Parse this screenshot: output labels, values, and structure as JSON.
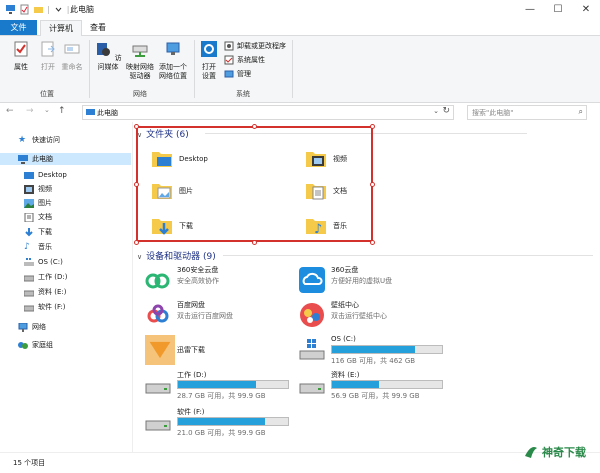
{
  "window": {
    "title": "此电脑",
    "quick_access_sep": "|",
    "minimize": "—",
    "maximize": "☐",
    "close": "✕"
  },
  "ribbon_tabs": {
    "file": "文件",
    "computer": "计算机",
    "view": "查看"
  },
  "ribbon": {
    "location_group": "位置",
    "network_group": "网络",
    "system_group": "系统",
    "properties": "属性",
    "open": "打开",
    "rename": "重命名",
    "access_media": "访问媒体",
    "map_drive_l1": "映射网络",
    "map_drive_l2": "驱动器",
    "add_location_l1": "添加一个",
    "add_location_l2": "网络位置",
    "open_settings_l1": "打开",
    "open_settings_l2": "设置",
    "uninstall": "卸载或更改程序",
    "sys_props": "系统属性",
    "manage": "管理"
  },
  "address": {
    "back": "←",
    "forward": "→",
    "recent": "⌄",
    "up": "↑",
    "path": "此电脑",
    "search_placeholder": "搜索\"此电脑\""
  },
  "nav_pane": {
    "quick_access": "快速访问",
    "this_pc": "此电脑",
    "desktop": "Desktop",
    "videos": "视频",
    "pictures": "图片",
    "documents": "文档",
    "downloads": "下载",
    "music": "音乐",
    "os_c": "OS (C:)",
    "work_d": "工作 (D:)",
    "data_e": "资料 (E:)",
    "soft_f": "软件 (F:)",
    "network": "网络",
    "homegroup": "家庭组"
  },
  "folders_section": {
    "header": "文件夹 (6)",
    "items": [
      "Desktop",
      "视频",
      "图片",
      "文档",
      "下载",
      "音乐"
    ]
  },
  "drives_section": {
    "header": "设备和驱动器 (9)",
    "yun360": {
      "name": "360安全云盘",
      "sub": "安全高效协作"
    },
    "yun360b": {
      "name": "360云盘",
      "sub": "方便好用的虚拟U盘"
    },
    "baidu": {
      "name": "百度网盘",
      "sub": "双击运行百度网盘"
    },
    "wallpaper": {
      "name": "壁纸中心",
      "sub": "双击运行壁纸中心"
    },
    "xunlei": {
      "name": "迅雷下载"
    },
    "c": {
      "name": "OS (C:)",
      "cap": "116 GB 可用，共 462 GB",
      "used": 0.75
    },
    "d": {
      "name": "工作 (D:)",
      "cap": "28.7 GB 可用，共 99.9 GB",
      "used": 0.71
    },
    "e": {
      "name": "资料 (E:)",
      "cap": "56.9 GB 可用，共 99.9 GB",
      "used": 0.43
    },
    "f": {
      "name": "软件 (F:)",
      "cap": "21.0 GB 可用，共 99.9 GB",
      "used": 0.79
    }
  },
  "status": {
    "count": "15 个项目"
  },
  "watermark": {
    "text": "神奇下载"
  },
  "colors": {
    "accent": "#1979ca",
    "bar": "#26a0da",
    "highlight": "#d2312c"
  }
}
